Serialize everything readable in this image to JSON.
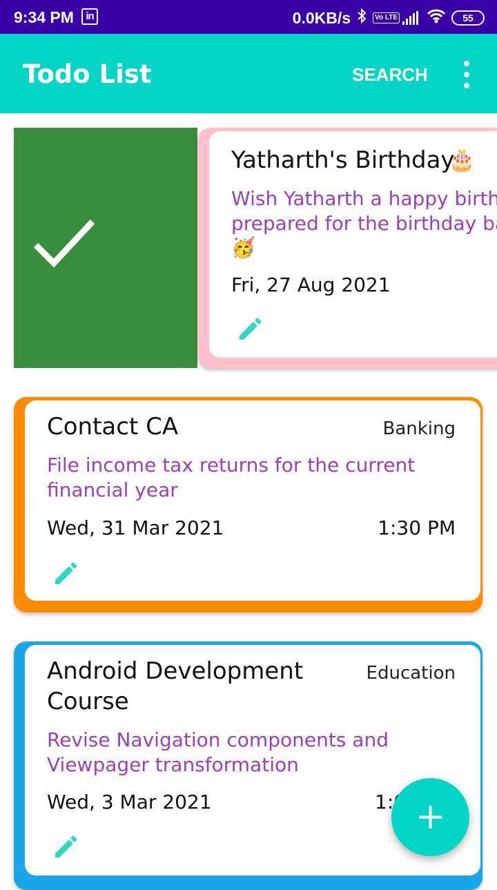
{
  "status_bar": {
    "time": "9:34 PM",
    "linkedin_icon": "in",
    "net_speed": "0.0KB/s",
    "bluetooth_icon": "bluetooth-icon",
    "volte_label": "Vo LTE",
    "battery": "55"
  },
  "app_bar": {
    "title": "Todo List",
    "search_label": "SEARCH",
    "more_icon": "more-vert-icon"
  },
  "colors": {
    "app_bar": "#03d6c6",
    "status_bar": "#3a00a8",
    "swipe_done": "#388e3c",
    "description": "#9c3fb7",
    "edit_icon": "#2fd8c4"
  },
  "todos": [
    {
      "title": "Yatharth's Birthday",
      "title_emoji": "🎂",
      "category": "",
      "description_line1": "Wish Yatharth a happy birthd",
      "description_line2": "prepared for the birthday ba",
      "description_emoji": "🥳",
      "date": "Fri, 27 Aug 2021",
      "time": "",
      "border_color": "#ffc0cb",
      "swiped": true
    },
    {
      "title": "Contact CA",
      "category": "Banking",
      "description_line1": "File income tax returns for the current",
      "description_line2": "financial year",
      "date": "Wed, 31 Mar 2021",
      "time": "1:30 PM",
      "border_color": "#ff8c00"
    },
    {
      "title_line1": "Android Development",
      "title_line2": "Course",
      "category": "Education",
      "description_line1": "Revise Navigation components and",
      "description_line2": "Viewpager transformation",
      "date": "Wed, 3 Mar 2021",
      "time": "1:0",
      "border_color": "#1aa7e8"
    }
  ],
  "fab": {
    "icon": "add-icon"
  }
}
